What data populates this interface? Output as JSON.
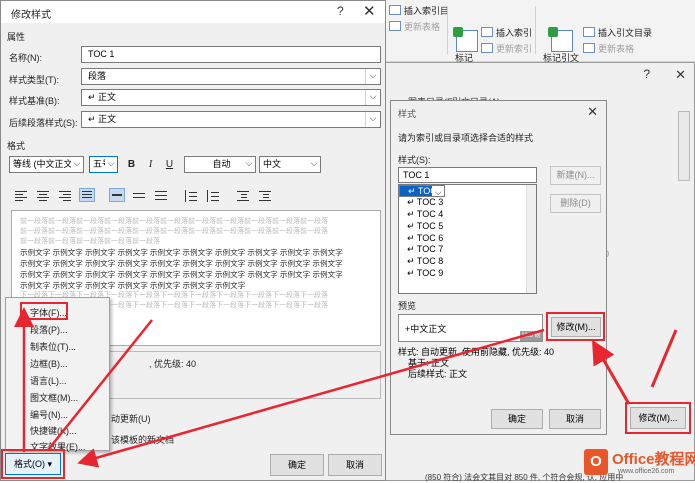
{
  "ribbon": {
    "insert_index_entry": "插入索引目",
    "update_table": "更新表格",
    "insert_index": "插入索引",
    "update_index": "更新索引",
    "mark_entry": "标记",
    "mark_citation": "标记引文",
    "insert_table_of_auth": "插入引文目录",
    "update_table_auth": "更新表格"
  },
  "toc_dialog": {
    "tab1": "图表目录(F)",
    "tab2": "引文目录(A)",
    "help_glyph": "?",
    "close_glyph": "✕",
    "modify_button": "修改(M)...",
    "faint_digit": "0"
  },
  "style_dialog": {
    "title": "样式",
    "close_glyph": "✕",
    "instruction": "请为索引或目录项选择合适的样式",
    "styles_label": "样式(S):",
    "current_value": "TOC 1",
    "items": [
      "↵ TOC 1",
      "↵ TOC 2",
      "↵ TOC 3",
      "↵ TOC 4",
      "↵ TOC 5",
      "↵ TOC 6",
      "↵ TOC 7",
      "↵ TOC 8",
      "↵ TOC 9"
    ],
    "new_button": "新建(N)...",
    "delete_button": "删除(D)",
    "preview_label": "预览",
    "preview_text": "+中文正文",
    "preview_size": "10.5 磅",
    "modify_button": "修改(M)...",
    "desc_line1": "样式: 自动更新, 使用前隐藏, 优先级: 40",
    "desc_line2": "基于: 正文",
    "desc_line3": "后续样式: 正文",
    "ok_button": "确定",
    "cancel_button": "取消"
  },
  "modify_dialog": {
    "title": "修改样式",
    "help_glyph": "?",
    "close_glyph": "✕",
    "properties_label": "属性",
    "name_label": "名称(N):",
    "name_value": "TOC 1",
    "type_label": "样式类型(T):",
    "type_value": "段落",
    "based_label": "样式基准(B):",
    "based_value": "↵ 正文",
    "following_label": "后续段落样式(S):",
    "following_value": "↵ 正文",
    "format_label": "格式",
    "font_value": "等线 (中文正文)",
    "size_value": "五号",
    "bold": "B",
    "italic": "I",
    "underline": "U",
    "color_value": "自动",
    "script_value": "中文",
    "preview_gray_line1": "前一段落前一段落前一段落前一段落前一段落前一段落前一段落前一段落前一段落前一段落前一段落",
    "preview_gray_line2": "前一段落前一段落前一段落前一段落前一段落前一段落前一段落前一段落前一段落前一段落前一段落",
    "preview_gray_line3": "前一段落前一段落前一段落前一段落前一段落",
    "preview_sample_line": "示例文字 示例文字 示例文字 示例文字 示例文字 示例文字 示例文字 示例文字 示例文字 示例文字",
    "preview_sample_line_last": "示例文字 示例文字 示例文字 示例文字 示例文字 示例文字 示例文字",
    "preview_next_line": "下一段落下一段落下一段落下一段落下一段落下一段落下一段落下一段落下一段落下一段落下一段落",
    "desc_text": ", 优先级: 40",
    "auto_update": "动更新(U)",
    "new_docs": "该模板的新文档",
    "ok_button": "确定",
    "cancel_button": "取消"
  },
  "format_menu": {
    "items": [
      "字体(F)...",
      "段落(P)...",
      "制表位(T)...",
      "边框(B)...",
      "语言(L)...",
      "图文框(M)...",
      "编号(N)...",
      "快捷键(K)...",
      "文字效果(E)..."
    ],
    "button_label": "格式(O) ▾"
  },
  "watermark": {
    "brand": "Office教程网",
    "url": "www.office26.com"
  },
  "bottom_text": "(850 符合) 法会文其目对 850 件, 个符合会规, 认, 应用中"
}
